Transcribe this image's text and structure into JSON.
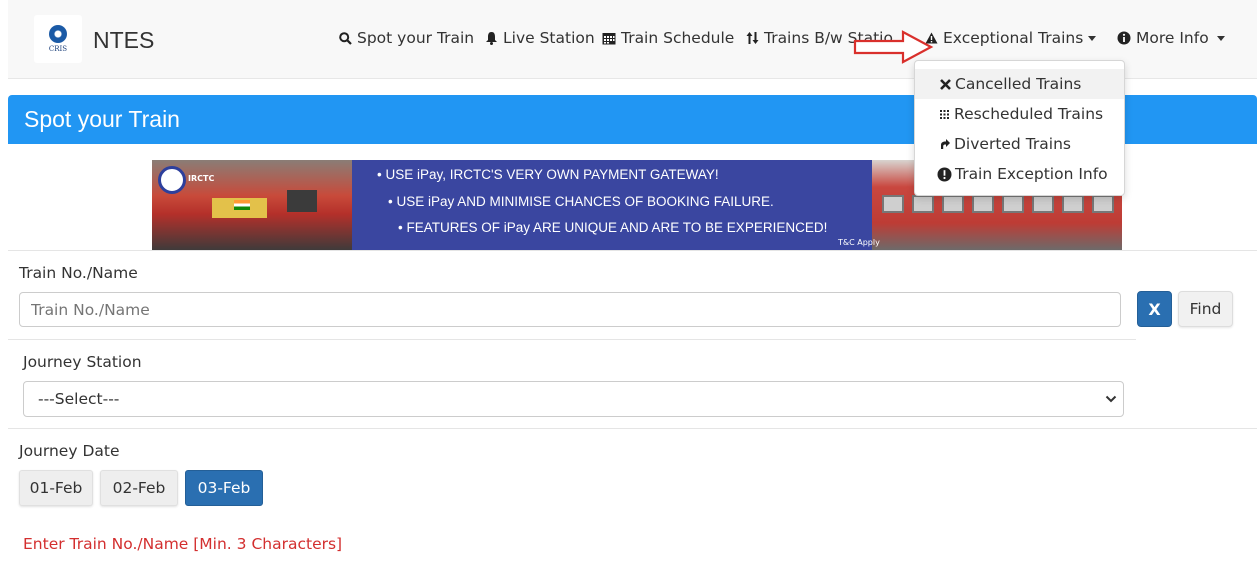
{
  "brand": "NTES",
  "nav": {
    "spot": "Spot your Train",
    "live": "Live Station",
    "schedule": "Train Schedule",
    "between": "Trains B/w Statio",
    "exceptional": "Exceptional Trains",
    "more": "More Info"
  },
  "dropdown": {
    "items": [
      "Cancelled Trains",
      "Rescheduled Trains",
      "Diverted Trains",
      "Train Exception Info"
    ]
  },
  "panel": {
    "title": "Spot your Train"
  },
  "banner": {
    "logo_text": "IRCTC",
    "line1": "• USE iPay, IRCTC'S VERY OWN PAYMENT GATEWAY!",
    "line2": "• USE iPay AND MINIMISE CHANCES OF BOOKING FAILURE.",
    "line3": "• FEATURES OF iPay ARE UNIQUE AND ARE TO BE EXPERIENCED!",
    "tc": "T&C Apply"
  },
  "form": {
    "train_label": "Train No./Name",
    "train_placeholder": "Train No./Name",
    "clear_label": "X",
    "find_label": "Find",
    "station_label": "Journey Station",
    "station_value": "---Select---",
    "date_label": "Journey Date",
    "dates": [
      "01-Feb",
      "02-Feb",
      "03-Feb"
    ],
    "selected_date": "03-Feb",
    "error": "Enter Train No./Name [Min. 3 Characters]"
  },
  "colors": {
    "header": "#2196f3",
    "primary_btn": "#2a6fb1",
    "error": "#d32f2f",
    "annotation_arrow": "#d9302c"
  }
}
